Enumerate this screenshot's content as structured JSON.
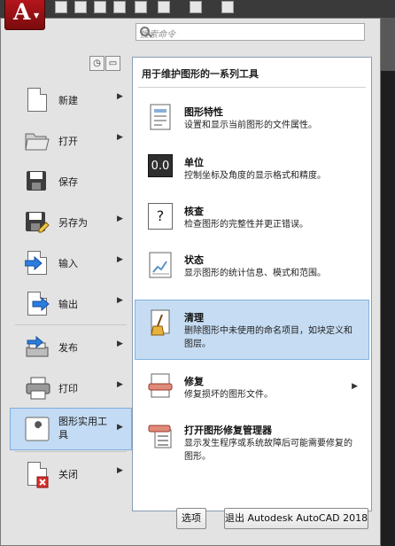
{
  "search": {
    "placeholder": "搜索命令"
  },
  "left_menu": {
    "items": [
      {
        "label": "新建",
        "icon": "new-doc-icon",
        "arrow": true
      },
      {
        "label": "打开",
        "icon": "open-folder-icon",
        "arrow": true
      },
      {
        "label": "保存",
        "icon": "save-disk-icon",
        "arrow": false
      },
      {
        "label": "另存为",
        "icon": "saveas-disk-icon",
        "arrow": true
      },
      {
        "label": "输入",
        "icon": "import-icon",
        "arrow": true
      },
      {
        "label": "输出",
        "icon": "export-icon",
        "arrow": true
      },
      {
        "label": "发布",
        "icon": "publish-icon",
        "arrow": true
      },
      {
        "label": "打印",
        "icon": "print-icon",
        "arrow": true
      },
      {
        "label": "图形实用工具",
        "icon": "drawing-utilities-icon",
        "arrow": true,
        "selected": true
      },
      {
        "label": "关闭",
        "icon": "close-doc-icon",
        "arrow": true
      }
    ]
  },
  "panel": {
    "title": "用于维护图形的一系列工具",
    "items": [
      {
        "title": "图形特性",
        "desc": "设置和显示当前图形的文件属性。",
        "icon": "drawing-properties-icon"
      },
      {
        "title": "单位",
        "desc": "控制坐标及角度的显示格式和精度。",
        "icon": "units-icon",
        "icon_text": "0.0"
      },
      {
        "title": "核查",
        "desc": "检查图形的完整性并更正错误。",
        "icon": "audit-icon",
        "icon_text": "?"
      },
      {
        "title": "状态",
        "desc": "显示图形的统计信息、模式和范围。",
        "icon": "status-chart-icon"
      },
      {
        "title": "清理",
        "desc": "删除图形中未使用的命名项目，如块定义和图层。",
        "icon": "purge-broom-icon",
        "highlighted": true
      },
      {
        "title": "修复",
        "desc": "修复损坏的图形文件。",
        "icon": "recover-icon",
        "arrow": true
      },
      {
        "title": "打开图形修复管理器",
        "desc": "显示发生程序或系统故障后可能需要修复的图形。",
        "icon": "recovery-manager-icon"
      }
    ]
  },
  "buttons": {
    "options": "选项",
    "exit": "退出 Autodesk AutoCAD 2018"
  },
  "colors": {
    "selection_bg": "#c3dbf4",
    "app_button": "#b4161b",
    "accent_blue": "#2b6fd1"
  }
}
